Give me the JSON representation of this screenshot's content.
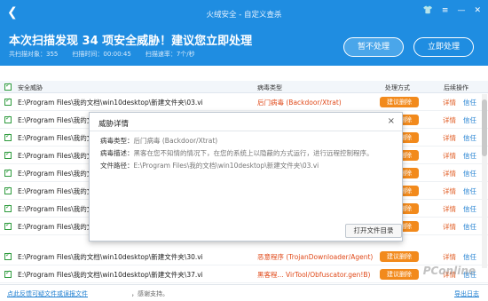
{
  "window": {
    "title": "火绒安全 - 自定义查杀",
    "controls": [
      "👕",
      "≡",
      "—",
      "✕"
    ]
  },
  "header": {
    "headline": "本次扫描发现 34 项安全威胁！建议您立即处理",
    "stats": [
      "共扫描对象：355",
      "扫描时间：00:00:45",
      "扫描速率：7个/秒"
    ],
    "ignore_label": "暂不处理",
    "fix_label": "立即处理"
  },
  "table": {
    "columns": [
      "安全威胁",
      "病毒类型",
      "处理方式",
      "后续操作"
    ],
    "rows": [
      {
        "path": "E:\\Program Files\\我的文档\\win10desktop\\新建文件夹\\03.vi",
        "type": "后门病毒 (Backdoor/Xtrat)",
        "action": "建议删除",
        "detail": "详情",
        "trust": "信任"
      },
      {
        "path": "E:\\Program Files\\我的文档\\win10desktop\\新建文件夹\\04.vi",
        "type": "",
        "action": "建议删除",
        "detail": "详情",
        "trust": "信任"
      },
      {
        "path": "E:\\Program Files\\我的文档\\win10desktop\\新建文件夹\\05.vi",
        "type": "",
        "action": "建议删除",
        "detail": "详情",
        "trust": "信任"
      },
      {
        "path": "E:\\Program Files\\我的文档\\win10desktop\\新建文件夹\\06.vi",
        "type": "",
        "action": "建议删除",
        "detail": "详情",
        "trust": "信任"
      },
      {
        "path": "E:\\Program Files\\我的文档\\win10desktop\\新建文件夹\\07.vi",
        "type": "",
        "action": "建议删除",
        "detail": "详情",
        "trust": "信任"
      },
      {
        "path": "E:\\Program Files\\我的文档\\win10desktop\\新建文件夹\\08.vi",
        "type": "",
        "action": "建议删除",
        "detail": "详情",
        "trust": "信任"
      },
      {
        "path": "E:\\Program Files\\我的文档\\win10desktop\\新建文件夹\\09.vi",
        "type": "",
        "action": "建议删除",
        "detail": "详情",
        "trust": "信任"
      },
      {
        "path": "E:\\Program Files\\我的文档\\win10desktop\\新建文件夹\\10.vi",
        "type": "",
        "action": "建议删除",
        "detail": "详情",
        "trust": "信任"
      },
      {
        "path": "E:\\Program Files\\我的文档\\win10desktop\\新建文件夹\\30.vi",
        "type": "恶意程序 (TrojanDownloader/Agent)",
        "action": "建议删除",
        "detail": "详情",
        "trust": "信任"
      },
      {
        "path": "E:\\Program Files\\我的文档\\win10desktop\\新建文件夹\\37.vi",
        "type": "黑客程... VirTool/Obfuscator.gen!B)",
        "action": "建议删除",
        "detail": "详情",
        "trust": "信任"
      }
    ]
  },
  "dialog": {
    "title": "威胁详情",
    "close": "×",
    "virus_type_key": "病毒类型：",
    "virus_type": "后门病毒 (Backdoor/Xtrat)",
    "desc_key": "病毒描述：",
    "desc": "黑客在您不知情的情况下，在您的系统上以隐蔽的方式运行，进行远程控制程序。",
    "path_key": "文件路径：",
    "path": "E:\\Program Files\\我的文档\\win10desktop\\新建文件夹\\03.vi",
    "open_label": "打开文件目录"
  },
  "footer": {
    "feedback": "点此反馈可疑文件或误报文件",
    "thanks": "，感谢支持。",
    "export": "导出日志"
  },
  "watermark": "PConline",
  "colors": {
    "header_bg": "#1f8de1",
    "danger_text": "#e04a1a",
    "action_orange": "#f28a1c",
    "link_blue": "#1f7fd1",
    "check_green": "#2e9b3d"
  }
}
